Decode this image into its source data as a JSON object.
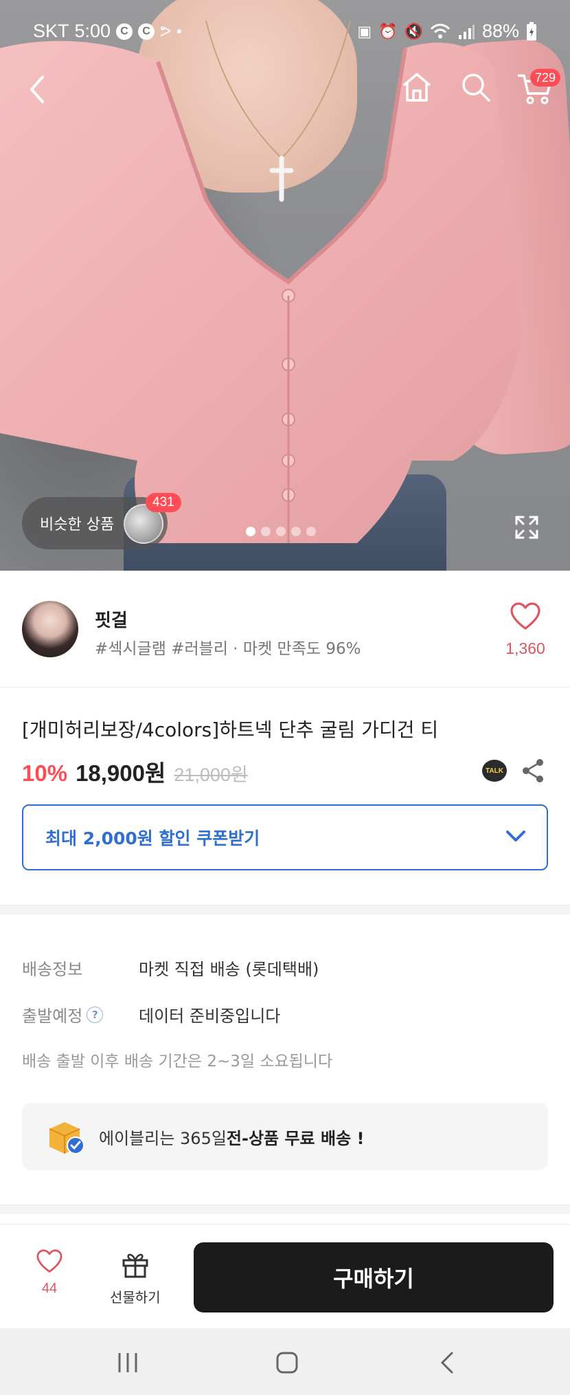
{
  "status_bar": {
    "carrier": "SKT",
    "time": "5:00",
    "notif_1": "C",
    "notif_2": "C",
    "battery": "88%"
  },
  "top_nav": {
    "cart_count": "729"
  },
  "gallery": {
    "similar_label": "비슷한 상품",
    "similar_count": "431",
    "image_count": 5,
    "active_index": 0
  },
  "seller": {
    "name": "핏걸",
    "tags": "#섹시글램 #러블리 · 마켓 만족도 96%",
    "likes": "1,360"
  },
  "product": {
    "title": "[개미허리보장/4colors]하트넥 단추 굴림 가디건 티",
    "discount": "10%",
    "price": "18,900원",
    "original_price": "21,000원",
    "talk_label": "TALK"
  },
  "coupon": {
    "label": "최대 2,000원 할인 쿠폰받기"
  },
  "shipping": {
    "info_label": "배송정보",
    "info_value": "마켓 직접 배송 (롯데택배)",
    "departure_label": "출발예정",
    "departure_help": "?",
    "departure_value": "데이터 준비중입니다",
    "note": "배송 출발 이후 배송 기간은 2~3일 소요됩니다",
    "free_prefix": "에이블리는 365일 ",
    "free_bold": "전-상품 무료 배송 !"
  },
  "action_bar": {
    "wish_count": "44",
    "gift_label": "선물하기",
    "buy_label": "구매하기"
  },
  "colors": {
    "accent_red": "#ff4d57",
    "coupon_blue": "#2f6fd1",
    "buy_bg": "#1b1b1b"
  }
}
